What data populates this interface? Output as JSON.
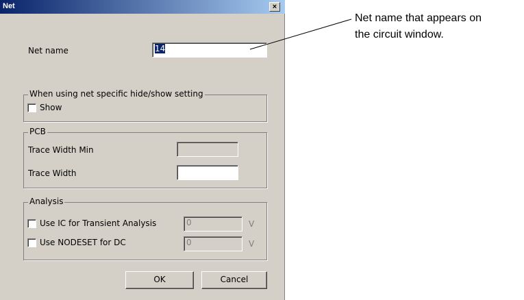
{
  "dialog": {
    "title": "Net",
    "close_icon": "close-icon",
    "net_name": {
      "label": "Net name",
      "value": "14"
    },
    "visibility_group": {
      "legend": "When using net specific hide/show setting",
      "show_label": "Show",
      "show_checked": false
    },
    "pcb_group": {
      "legend": "PCB",
      "trace_min_label": "Trace Width Min",
      "trace_min_value": "",
      "trace_width_label": "Trace Width",
      "trace_width_value": ""
    },
    "analysis_group": {
      "legend": "Analysis",
      "ic_label": "Use IC for Transient Analysis",
      "ic_checked": false,
      "ic_value": "0",
      "ic_unit": "V",
      "nodeset_label": "Use NODESET for DC",
      "nodeset_checked": false,
      "nodeset_value": "0",
      "nodeset_unit": "V"
    },
    "ok_label": "OK",
    "cancel_label": "Cancel"
  },
  "annotation": {
    "line1": "Net name that appears on",
    "line2": "the circuit window."
  }
}
